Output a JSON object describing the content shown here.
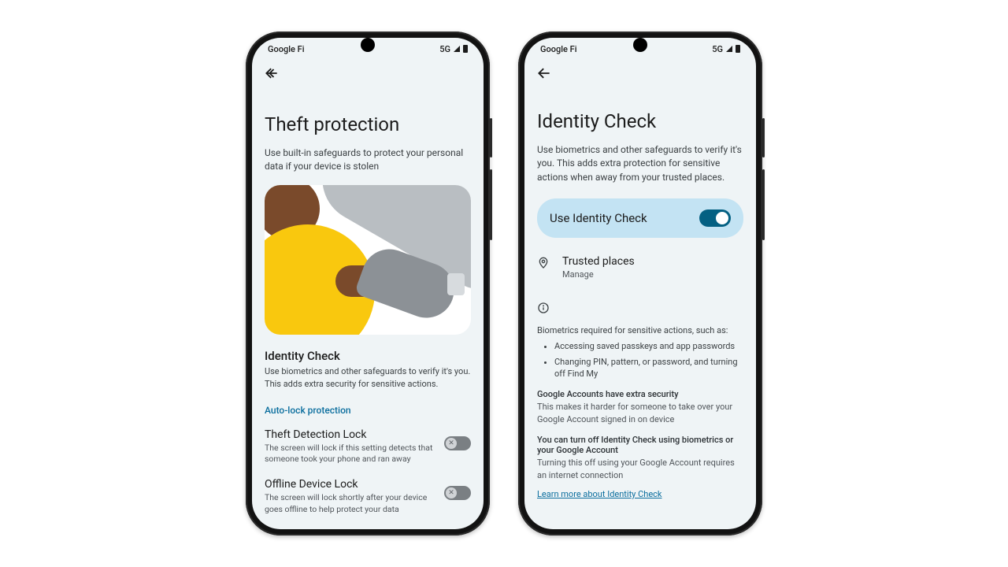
{
  "status": {
    "carrier": "Google Fi",
    "net": "5G"
  },
  "left": {
    "title": "Theft protection",
    "subtitle": "Use built-in safeguards to protect your personal data if your device is stolen",
    "identity": {
      "title": "Identity Check",
      "sub": "Use biometrics and other safeguards to verify it's you. This adds extra security for sensitive actions."
    },
    "autolock_header": "Auto-lock protection",
    "theft_lock": {
      "title": "Theft Detection Lock",
      "sub": "The screen will lock if this setting detects that someone took your phone and ran away"
    },
    "offline_lock": {
      "title": "Offline Device Lock",
      "sub": "The screen will lock shortly after your device goes offline to help protect your data"
    }
  },
  "right": {
    "title": "Identity Check",
    "subtitle": "Use biometrics and other safeguards to verify it's you. This adds extra protection for sensitive actions when away from your trusted places.",
    "toggle_label": "Use Identity Check",
    "trusted": {
      "title": "Trusted places",
      "sub": "Manage"
    },
    "info_head": "Biometrics required for sensitive actions, such as:",
    "bullet1": "Accessing saved passkeys and app passwords",
    "bullet2": "Changing PIN, pattern, or password, and turning off Find My",
    "acct_head": "Google Accounts have extra security",
    "acct_body": "This makes it harder for someone to take over your Google Account signed in on device",
    "turnoff_head": "You can turn off Identity Check using biometrics or your Google Account",
    "turnoff_body": "Turning this off using your Google Account requires an internet connection",
    "learn": "Learn more about Identity Check"
  }
}
